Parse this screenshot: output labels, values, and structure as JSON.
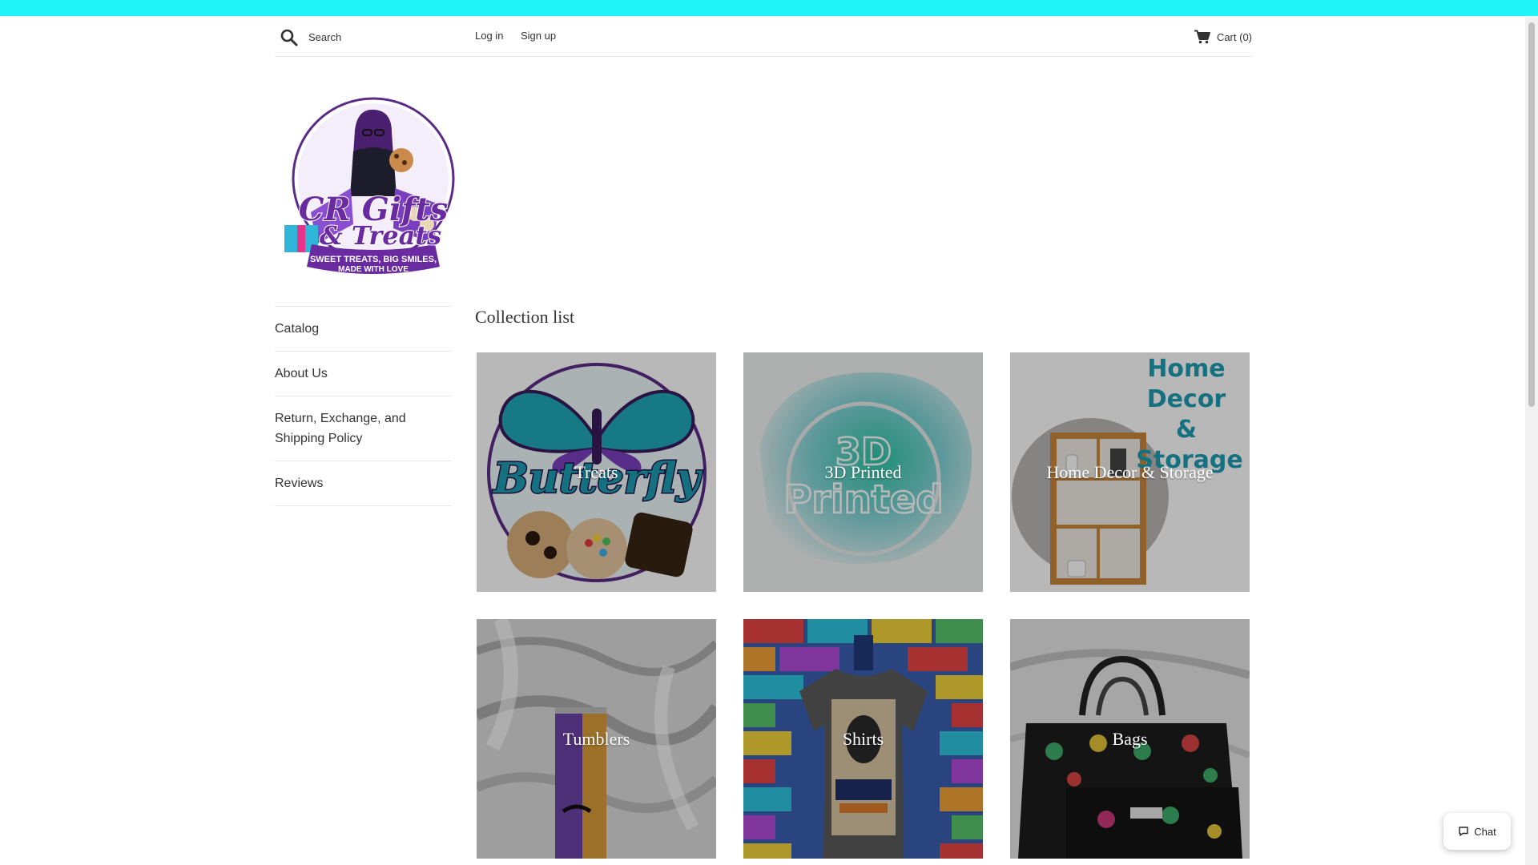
{
  "header": {
    "search_placeholder": "Search",
    "login_label": "Log in",
    "signup_label": "Sign up",
    "cart_label": "Cart (0)",
    "icons": {
      "search": "search-icon",
      "cart": "cart-icon"
    }
  },
  "logo": {
    "brand_name": "CR Gifts & Treats",
    "tagline": "SWEET TREATS, BIG SMILES, MADE WITH LOVE"
  },
  "sidebar": {
    "items": [
      {
        "label": "Catalog"
      },
      {
        "label": "About Us"
      },
      {
        "label": "Return, Exchange, and Shipping Policy"
      },
      {
        "label": "Reviews"
      }
    ]
  },
  "main": {
    "title": "Collection list",
    "collections": [
      {
        "label": "Treats"
      },
      {
        "label": "3D Printed"
      },
      {
        "label": "Home Decor & Storage"
      },
      {
        "label": "Tumblers"
      },
      {
        "label": "Shirts"
      },
      {
        "label": "Bags"
      }
    ]
  },
  "chat": {
    "label": "Chat",
    "icon": "chat-bubble-icon"
  },
  "colors": {
    "topbar": "#1ff4f7",
    "text": "#333333",
    "divider": "#e6e6e6"
  }
}
